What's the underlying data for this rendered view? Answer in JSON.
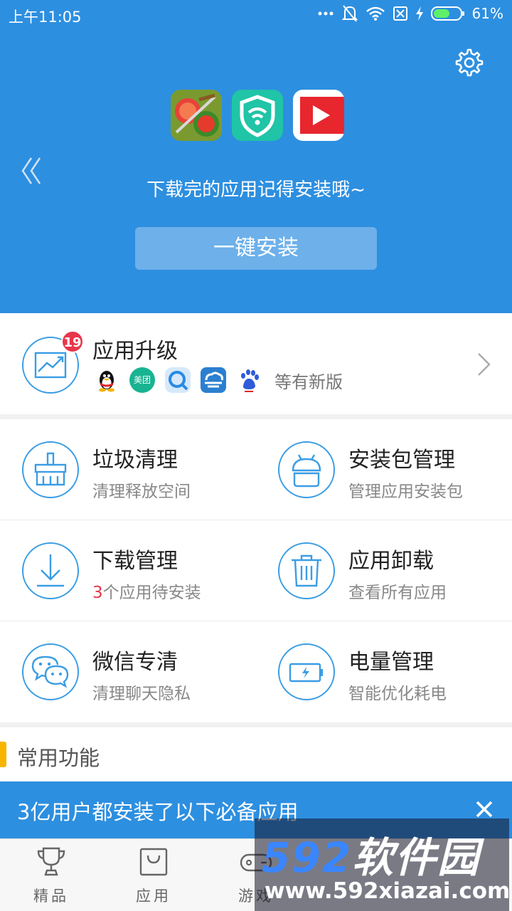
{
  "status_bar": {
    "time": "上午11:05",
    "battery_percent": "61%",
    "battery_level": 0.61
  },
  "header": {
    "settings_icon": "gear-icon",
    "back_icon": "double-chevron-left-icon",
    "apps": [
      "fruit-ninja-icon",
      "wifi-shield-icon",
      "video-play-icon"
    ],
    "message": "下载完的应用记得安装哦~",
    "install_button": "一键安装",
    "bg_color": "#2d8fe0"
  },
  "upgrade": {
    "title": "应用升级",
    "badge": "19",
    "apps": [
      "qq-penguin-icon",
      "meituan-icon",
      "browser-search-icon",
      "weather-cloud-icon",
      "baidu-paw-icon"
    ],
    "meituan_text": "美团",
    "suffix": "等有新版"
  },
  "tools": [
    {
      "title": "垃圾清理",
      "sub": "清理释放空间",
      "icon": "broom-icon"
    },
    {
      "title": "安装包管理",
      "sub": "管理应用安装包",
      "icon": "android-package-icon"
    },
    {
      "title": "下载管理",
      "sub_highlight": "3",
      "sub": "个应用待安装",
      "icon": "download-icon"
    },
    {
      "title": "应用卸载",
      "sub": "查看所有应用",
      "icon": "trash-icon"
    },
    {
      "title": "微信专清",
      "sub": "清理聊天隐私",
      "icon": "wechat-icon"
    },
    {
      "title": "电量管理",
      "sub": "智能优化耗电",
      "icon": "battery-icon"
    }
  ],
  "common": {
    "title": "常用功能"
  },
  "banner": {
    "text": "3亿用户都安装了以下必备应用",
    "close_icon": "close-icon"
  },
  "bottom_nav": [
    {
      "label": "精品",
      "icon": "trophy-icon"
    },
    {
      "label": "应用",
      "icon": "shopping-bag-icon"
    },
    {
      "label": "游戏",
      "icon": "gamepad-icon"
    },
    {
      "label": "",
      "icon": ""
    },
    {
      "label": "",
      "icon": ""
    }
  ],
  "watermark": {
    "brand_num": "592",
    "brand_cn": "软件园",
    "url": "www.592xiazai.com"
  },
  "colors": {
    "accent_blue": "#2d8fe0",
    "badge_red": "#e8364a",
    "section_yellow": "#f7b500"
  }
}
